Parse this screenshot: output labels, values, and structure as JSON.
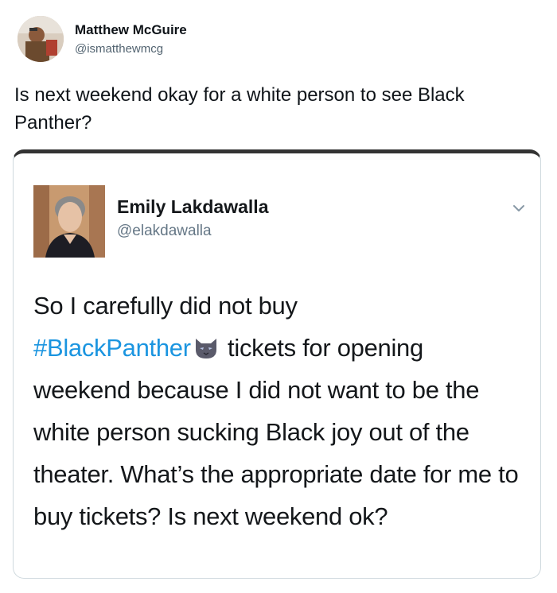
{
  "outer_tweet": {
    "author_name": "Matthew McGuire",
    "author_handle": "@ismatthewmcg",
    "text": "Is next weekend okay for a white person to see Black Panther?"
  },
  "quoted_tweet": {
    "author_name": "Emily Lakdawalla",
    "author_handle": "@elakdawalla",
    "text_before": "So I carefully did not buy",
    "hashtag": "#BlackPanther",
    "emoji": "cat-face-emoji",
    "text_after": " tickets for opening weekend because I did not want to be the white person sucking Black joy out of the theater. What’s the appropriate date for me to buy tickets? Is next weekend ok?"
  },
  "colors": {
    "hashtag": "#1b95e0",
    "handle": "#657786",
    "border": "#cfd9de"
  }
}
